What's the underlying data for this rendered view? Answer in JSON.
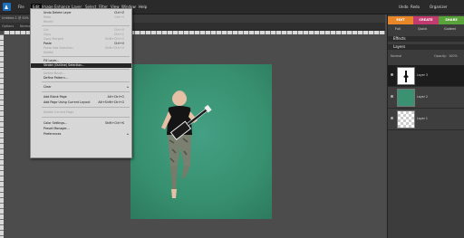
{
  "menubar": {
    "items": [
      "File",
      "Edit",
      "Image",
      "Enhance",
      "Layer",
      "Select",
      "Filter",
      "View",
      "Window",
      "Help"
    ],
    "right": {
      "undo": "Undo",
      "redo": "Redo",
      "organizer": "Organizer"
    }
  },
  "tabs": {
    "doc": "Untitled-1 @ 50% (Layer 1, RGB/8)"
  },
  "options": {
    "label": "Options",
    "value": "Normal"
  },
  "edit_menu": {
    "items": [
      {
        "label": "Undo Delete Layer",
        "shortcut": "Ctrl+Z",
        "state": "normal"
      },
      {
        "label": "Redo",
        "shortcut": "Ctrl+Y",
        "state": "disabled"
      },
      {
        "label": "Revert",
        "shortcut": "",
        "state": "disabled"
      },
      {
        "label": "Cut",
        "shortcut": "Ctrl+X",
        "state": "disabled"
      },
      {
        "label": "Copy",
        "shortcut": "Ctrl+C",
        "state": "disabled"
      },
      {
        "label": "Copy Merged",
        "shortcut": "Shift+Ctrl+C",
        "state": "disabled"
      },
      {
        "label": "Paste",
        "shortcut": "Ctrl+V",
        "state": "normal"
      },
      {
        "label": "Paste Into Selection",
        "shortcut": "Shift+Ctrl+V",
        "state": "disabled"
      },
      {
        "label": "Delete",
        "shortcut": "",
        "state": "disabled"
      },
      {
        "label": "Fill Layer...",
        "shortcut": "",
        "state": "normal"
      },
      {
        "label": "Stroke (Outline) Selection...",
        "shortcut": "",
        "state": "highlight"
      },
      {
        "label": "Define Brush...",
        "shortcut": "",
        "state": "disabled"
      },
      {
        "label": "Define Pattern...",
        "shortcut": "",
        "state": "normal"
      },
      {
        "label": "Clear",
        "shortcut": "",
        "state": "normal"
      },
      {
        "label": "Add Blank Page",
        "shortcut": "Alt+Ctrl+G",
        "state": "normal"
      },
      {
        "label": "Add Page Using Current Layout",
        "shortcut": "Alt+Shift+Ctrl+G",
        "state": "normal"
      },
      {
        "label": "Delete Current Page",
        "shortcut": "",
        "state": "disabled"
      },
      {
        "label": "Color Settings...",
        "shortcut": "Shift+Ctrl+K",
        "state": "normal"
      },
      {
        "label": "Preset Manager...",
        "shortcut": "",
        "state": "normal"
      },
      {
        "label": "Preferences",
        "shortcut": "",
        "state": "normal"
      }
    ]
  },
  "panel": {
    "modes": [
      {
        "label": "EDIT",
        "color": "#e8862a"
      },
      {
        "label": "CREATE",
        "color": "#c23b6e"
      },
      {
        "label": "SHARE",
        "color": "#5aa23a"
      }
    ],
    "subtabs": [
      "Full",
      "Quick",
      "Guided"
    ],
    "effects_title": "Effects",
    "layers_title": "Layers",
    "blend_mode": "Normal",
    "opacity_label": "Opacity:",
    "opacity_value": "100%",
    "layers": [
      {
        "name": "Layer 3",
        "selected": true
      },
      {
        "name": "Layer 2",
        "selected": false
      },
      {
        "name": "Layer 1",
        "selected": false
      }
    ]
  }
}
